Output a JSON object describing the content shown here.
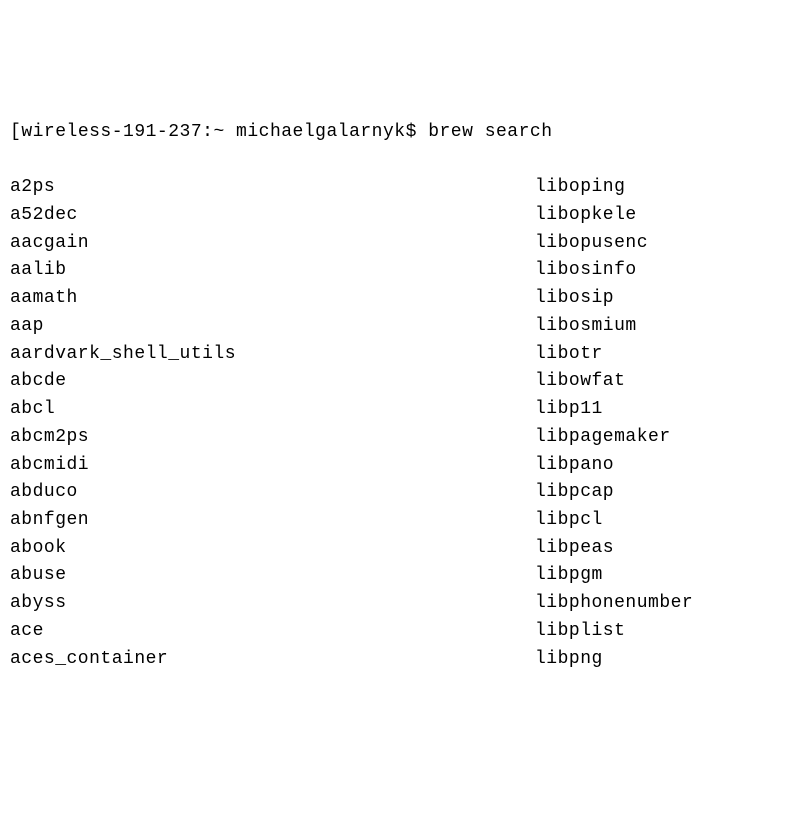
{
  "prompt": {
    "bracket_open": "[",
    "host_path": "wireless-191-237:~ michaelgalarnyk",
    "dollar": "$ ",
    "command": "brew search"
  },
  "packages_left": [
    "a2ps",
    "a52dec",
    "aacgain",
    "aalib",
    "aamath",
    "aap",
    "aardvark_shell_utils",
    "abcde",
    "abcl",
    "abcm2ps",
    "abcmidi",
    "abduco",
    "abnfgen",
    "abook",
    "abuse",
    "abyss",
    "ace",
    "aces_container"
  ],
  "packages_right": [
    "liboping",
    "libopkele",
    "libopusenc",
    "libosinfo",
    "libosip",
    "libosmium",
    "libotr",
    "libowfat",
    "libp11",
    "libpagemaker",
    "libpano",
    "libpcap",
    "libpcl",
    "libpeas",
    "libpgm",
    "libphonenumber",
    "libplist",
    "libpng"
  ]
}
